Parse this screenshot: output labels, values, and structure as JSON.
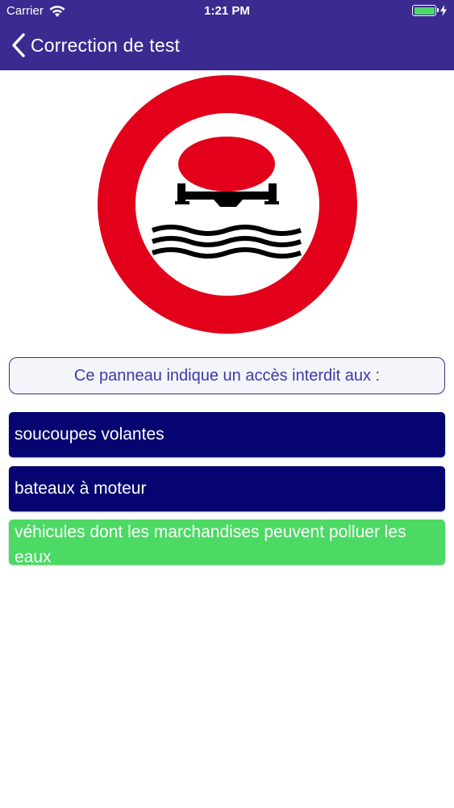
{
  "status_bar": {
    "carrier": "Carrier",
    "time": "1:21 PM"
  },
  "nav": {
    "title": "Correction de test",
    "back_icon": "chevron-left-icon"
  },
  "sign": {
    "icon": "no-polluting-goods-on-water-sign",
    "colors": {
      "ring": "#e2001a",
      "inner": "#ffffff",
      "symbol": "#000000"
    }
  },
  "question": {
    "text": "Ce panneau indique un accès interdit aux :"
  },
  "answers": [
    {
      "text": "soucoupes volantes",
      "state": "incorrect"
    },
    {
      "text": "bateaux à moteur",
      "state": "incorrect"
    },
    {
      "text": "véhicules dont les marchandises peuvent polluer les eaux",
      "state": "correct"
    }
  ],
  "colors": {
    "header": "#3b2a8f",
    "answer_default": "#050470",
    "answer_correct": "#4cd964",
    "question_text": "#3b3aa8"
  }
}
